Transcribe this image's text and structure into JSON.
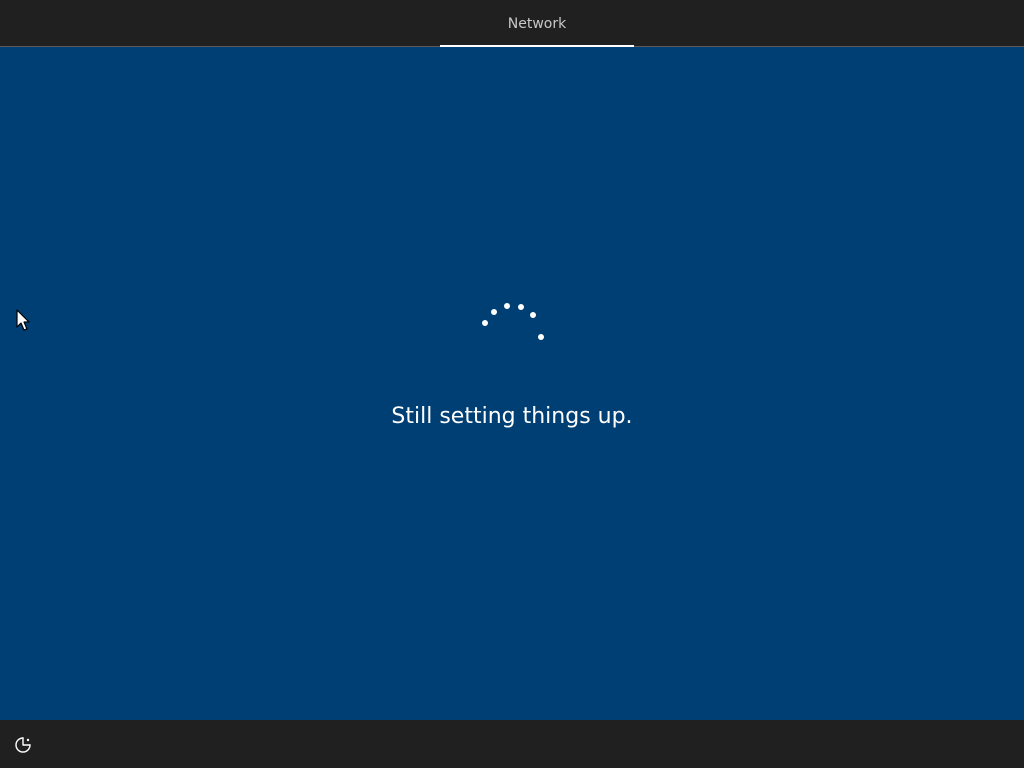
{
  "header": {
    "tabs": [
      {
        "label": "Network",
        "active": true
      }
    ]
  },
  "main": {
    "status_text": "Still setting things up.",
    "spinner": "loading-spinner"
  },
  "footer": {
    "ease_of_access_icon": "ease-of-access-icon"
  },
  "colors": {
    "background": "#003f74",
    "bars": "#202020",
    "text": "#ffffff",
    "tab_text": "#c8c8c8"
  }
}
